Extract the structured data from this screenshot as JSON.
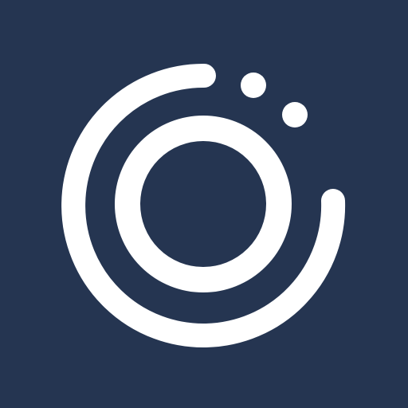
{
  "app_icon": {
    "name": "orbit-logo",
    "icon": "orbit-rings-icon",
    "colors": {
      "background": "#253551",
      "foreground": "#ffffff"
    }
  }
}
